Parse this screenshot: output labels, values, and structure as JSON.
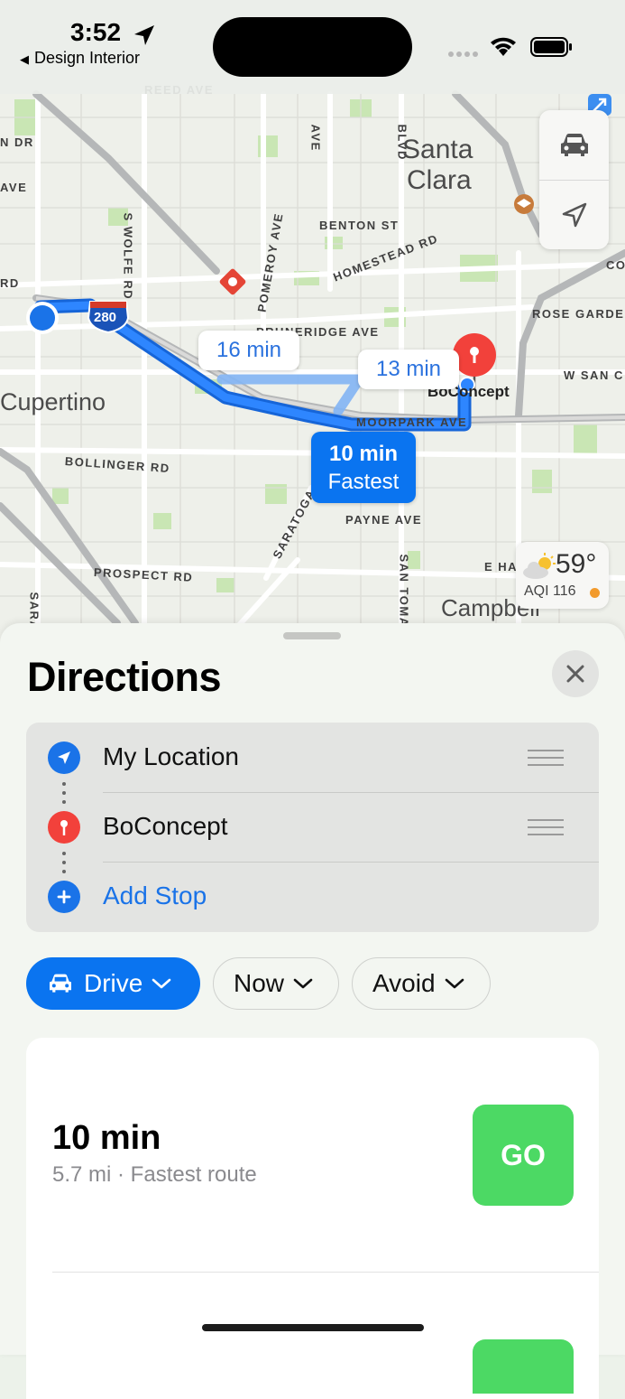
{
  "status_bar": {
    "time": "3:52",
    "back_app": "Design Interior"
  },
  "map": {
    "labels": {
      "reed_ave": "REED AVE",
      "n_dr": "N DR",
      "ave_left": "AVE",
      "rd_left": "RD",
      "s_wolfe_rd": "S WOLFE RD",
      "ave_top": "AVE",
      "blvd": "BLVD",
      "pomeroy_ave": "POMEROY AVE",
      "benton_st": "BENTON ST",
      "homestead_rd": "HOMESTEAD RD",
      "pruneridge_ave": "PRUNERIDGE AVE",
      "rose_garden": "ROSE GARDEN",
      "w_san": "W SAN C",
      "moorpark_ave": "MOORPARK AVE",
      "bollinger_rd": "BOLLINGER RD",
      "saratoga": "SARATOGA",
      "payne_ave": "PAYNE AVE",
      "san_tomas": "SAN TOMAS",
      "prospect_rd": "PROSPECT RD",
      "e_ham": "E HAM",
      "sara": "SARA",
      "co": "CO",
      "interstate": "280"
    },
    "cities": {
      "santa_clara_1": "Santa",
      "santa_clara_2": "Clara",
      "cupertino": "Cupertino",
      "campbell": "Campbell"
    },
    "destination_label": "BoConcept",
    "routes": [
      {
        "label": "16 min",
        "fastest": false
      },
      {
        "label": "13 min",
        "fastest": false
      },
      {
        "label": "10 min",
        "sublabel": "Fastest",
        "fastest": true
      }
    ],
    "weather": {
      "temp": "59°",
      "aqi": "AQI 116"
    },
    "controls": {
      "car_icon": "car-icon",
      "location_icon": "location-arrow-icon"
    }
  },
  "sheet": {
    "title": "Directions",
    "waypoints": [
      {
        "label": "My Location",
        "icon": "location-arrow-icon",
        "color": "#1a73e8"
      },
      {
        "label": "BoConcept",
        "icon": "pin-icon",
        "color": "#f2413b"
      },
      {
        "label": "Add Stop",
        "icon": "plus-icon",
        "color": "#1a73e8"
      }
    ],
    "chips": {
      "drive": "Drive",
      "now": "Now",
      "avoid": "Avoid"
    },
    "route": {
      "time": "10 min",
      "detail": "5.7 mi · Fastest route",
      "go": "GO"
    }
  },
  "colors": {
    "accent": "#0a74f0",
    "go_green": "#4cd964",
    "pin_red": "#f2413b"
  }
}
